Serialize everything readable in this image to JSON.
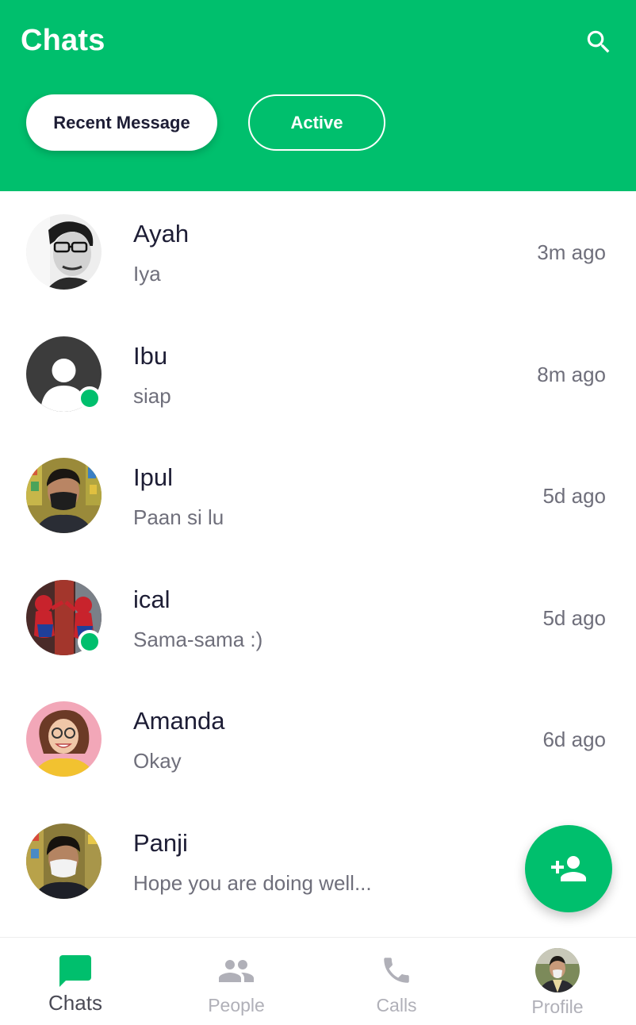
{
  "header": {
    "title": "Chats",
    "search_icon": "search-icon",
    "filters": {
      "recent": "Recent Message",
      "active": "Active"
    }
  },
  "colors": {
    "primary": "#00bf6d",
    "text_dark": "#1d1d35",
    "text_muted": "#6f6f7b",
    "nav_inactive": "#b0b0b8"
  },
  "chats": [
    {
      "name": "Ayah",
      "message": "Iya",
      "time": "3m ago",
      "online": false,
      "avatar": "photo-avatar-glasses-man"
    },
    {
      "name": "Ibu",
      "message": "siap",
      "time": "8m ago",
      "online": true,
      "avatar": "default-user-avatar"
    },
    {
      "name": "Ipul",
      "message": "Paan si lu",
      "time": "5d ago",
      "online": false,
      "avatar": "photo-avatar-masked-man"
    },
    {
      "name": "ical",
      "message": "Sama-sama :)",
      "time": "5d ago",
      "online": true,
      "avatar": "photo-avatar-spiderman"
    },
    {
      "name": "Amanda",
      "message": "Okay",
      "time": "6d ago",
      "online": false,
      "avatar": "photo-avatar-smiling-woman"
    },
    {
      "name": "Panji",
      "message": "Hope you are doing well...",
      "time": "",
      "online": false,
      "avatar": "photo-avatar-masked-boy"
    }
  ],
  "fab": {
    "icon": "add-person-icon"
  },
  "nav": {
    "chats": "Chats",
    "people": "People",
    "calls": "Calls",
    "profile": "Profile"
  }
}
